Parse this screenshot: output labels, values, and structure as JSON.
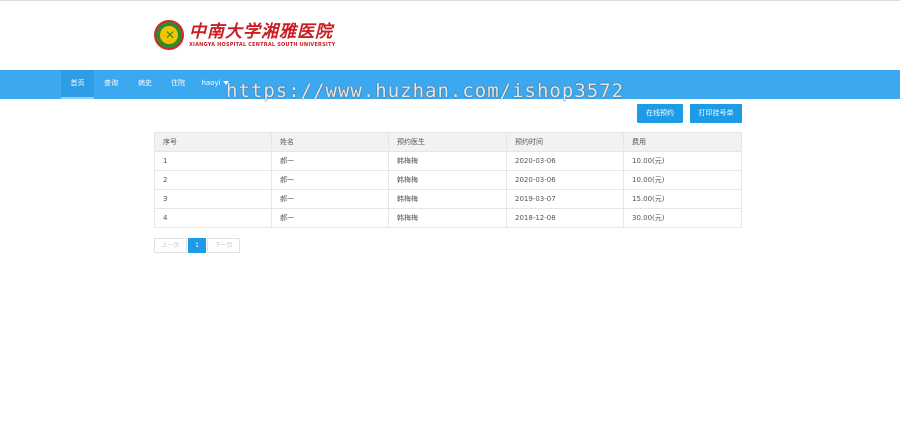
{
  "logo": {
    "name_cn": "中南大学湘雅医院",
    "name_en": "XIANGYA HOSPITAL CENTRAL SOUTH UNIVERSITY"
  },
  "nav": {
    "items": [
      "首页",
      "查询",
      "病史",
      "住院"
    ],
    "user": "haoyi"
  },
  "watermark": "https://www.huzhan.com/ishop3572",
  "actions": {
    "online_booking": "在线预约",
    "print_ticket": "打印挂号单"
  },
  "table": {
    "headers": [
      "序号",
      "姓名",
      "预约医生",
      "预约时间",
      "费用"
    ],
    "rows": [
      [
        "1",
        "郝一",
        "韩梅梅",
        "2020-03-06",
        "10.00(元)"
      ],
      [
        "2",
        "郝一",
        "韩梅梅",
        "2020-03-06",
        "10.00(元)"
      ],
      [
        "3",
        "郝一",
        "韩梅梅",
        "2019-03-07",
        "15.00(元)"
      ],
      [
        "4",
        "郝一",
        "韩梅梅",
        "2018-12-08",
        "30.00(元)"
      ]
    ]
  },
  "pagination": {
    "prev": "上一页",
    "current": "1",
    "next": "下一页"
  },
  "colors": {
    "nav_bg": "#3ba8f0",
    "button_bg": "#1e9be6",
    "brand_red": "#c81e24"
  }
}
